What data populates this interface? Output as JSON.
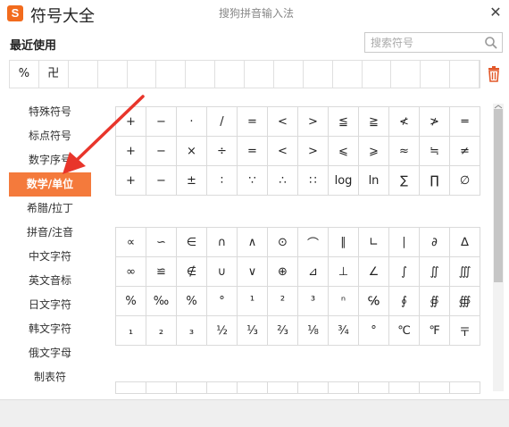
{
  "header": {
    "logo_text": "S",
    "title": "符号大全",
    "subtitle": "搜狗拼音输入法",
    "close_glyph": "✕"
  },
  "recent": {
    "label": "最近使用",
    "items": [
      "%",
      "卍",
      "",
      "",
      "",
      "",
      "",
      "",
      "",
      "",
      "",
      "",
      "",
      "",
      "",
      ""
    ]
  },
  "search": {
    "placeholder": "搜索符号"
  },
  "sidebar": {
    "items": [
      {
        "label": "特殊符号"
      },
      {
        "label": "标点符号"
      },
      {
        "label": "数字序号"
      },
      {
        "label": "数学/单位",
        "active": true
      },
      {
        "label": "希腊/拉丁"
      },
      {
        "label": "拼音/注音"
      },
      {
        "label": "中文字符"
      },
      {
        "label": "英文音标"
      },
      {
        "label": "日文字符"
      },
      {
        "label": "韩文字符"
      },
      {
        "label": "俄文字母"
      },
      {
        "label": "制表符"
      }
    ]
  },
  "grid1": [
    [
      "+",
      "−",
      "·",
      "/",
      "=",
      "<",
      ">",
      "≦",
      "≧",
      "≮",
      "≯",
      "═"
    ],
    [
      "+",
      "−",
      "×",
      "÷",
      "=",
      "<",
      ">",
      "⩽",
      "⩾",
      "≈",
      "≒",
      "≠"
    ],
    [
      "+",
      "−",
      "±",
      "∶",
      "∵",
      "∴",
      "∷",
      "log",
      "ln",
      "∑",
      "∏",
      "∅"
    ]
  ],
  "grid2": [
    [
      "∝",
      "∽",
      "∈",
      "∩",
      "∧",
      "⊙",
      "⌒",
      "∥",
      "∟",
      "∣",
      "∂",
      "∆"
    ],
    [
      "∞",
      "≌",
      "∉",
      "∪",
      "∨",
      "⊕",
      "⊿",
      "⊥",
      "∠",
      "∫",
      "∬",
      "∭"
    ],
    [
      "%",
      "‰",
      "%",
      "°",
      "¹",
      "²",
      "³",
      "ⁿ",
      "℅",
      "∮",
      "∯",
      "∰"
    ],
    [
      "₁",
      "₂",
      "₃",
      "½",
      "⅓",
      "⅔",
      "⅛",
      "¾",
      "°",
      "℃",
      "℉",
      "〒"
    ]
  ],
  "colors": {
    "accent": "#f47a3c",
    "logo": "#f26b1d",
    "trash": "#e2582a",
    "arrow": "#e8352b"
  },
  "icons": {
    "search": "search-icon",
    "trash": "trash-icon",
    "close": "close-icon",
    "arrow": "annotation-arrow"
  }
}
